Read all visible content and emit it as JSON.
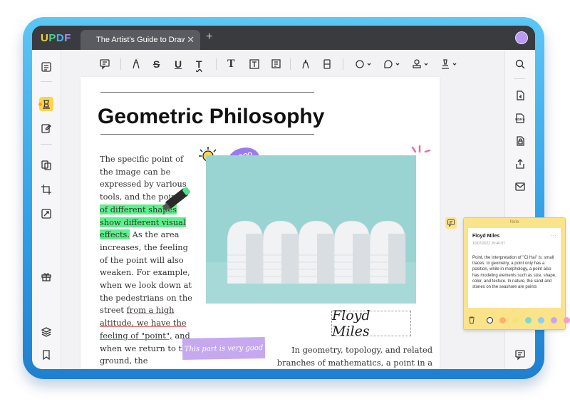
{
  "app": {
    "logo": "UPDF",
    "logo_colors": [
      "#f0d045",
      "#4ed09a",
      "#4bb3f0",
      "#b48af2"
    ]
  },
  "tab": {
    "title": "The Artist's Guide to Drawing",
    "close": "✕"
  },
  "new_tab": "+",
  "toolbar": {
    "text_tools": [
      "T"
    ]
  },
  "document": {
    "heading": "Geometric Philosophy",
    "col1": {
      "pre": "The specific point of the image can be expressed by various tools, and the points ",
      "highlight": "of different shapes show different visual effects.",
      "mid": " As the area increases, the feeling of the point will also weaken. For example, when we look down at the pedestrians on the street ",
      "underline": "from a high altitude, we have the feeling of \"point\",",
      "post": " and when we return to the ground, the"
    },
    "signature": "Floyd Miles",
    "col2": "In geometry, topology, and related branches of mathematics, a point in a space is used to describe a particular",
    "sticker_text": "GOOD TRY",
    "sticky_text": "This part is very good"
  },
  "note": {
    "header": "Note",
    "author": "Floyd Miles",
    "date": "10/07/2022 20:46:07",
    "more": "···",
    "text": "Point, the interpretation of \"Ci Hai\" is: small traces. In geometry, a point only has a position, while in morphology, a point also has modeling elements such as size, shape, color, and texture. In nature, the sand and stones on the seashore are points",
    "colors": [
      "#ffffff",
      "#f6b46e",
      "#f5e27a",
      "#7fd9c8",
      "#8ccff0",
      "#c3a7ef",
      "#f59fc4"
    ],
    "selected_color_index": 0
  }
}
